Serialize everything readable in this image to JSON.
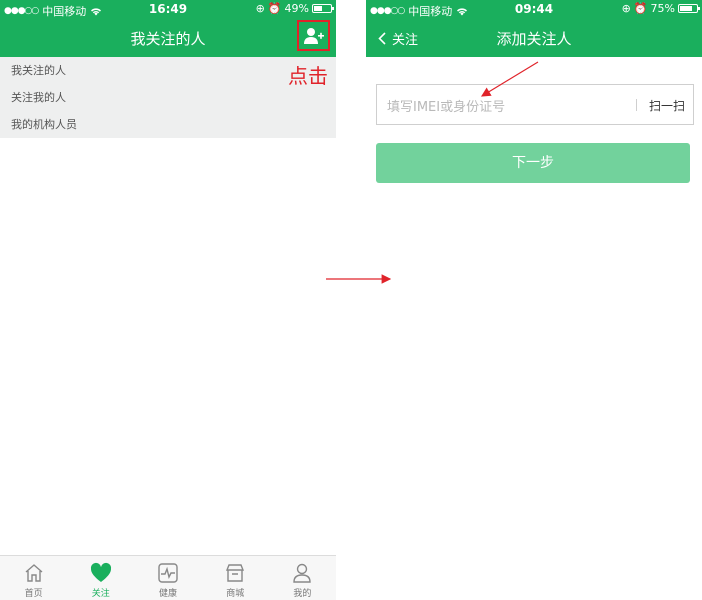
{
  "left_screen": {
    "status": {
      "carrier": "中国移动",
      "time": "16:49",
      "battery": "49%",
      "battery_level": 0.49
    },
    "nav": {
      "title": "我关注的人",
      "add_icon": "add-user-icon"
    },
    "menu": [
      "我关注的人",
      "关注我的人",
      "我的机构人员"
    ],
    "annotation": "点击",
    "tabs": [
      {
        "label": "首页",
        "icon": "home-icon",
        "active": false
      },
      {
        "label": "关注",
        "icon": "heart-icon",
        "active": true
      },
      {
        "label": "健康",
        "icon": "health-icon",
        "active": false
      },
      {
        "label": "商城",
        "icon": "store-icon",
        "active": false
      },
      {
        "label": "我的",
        "icon": "person-icon",
        "active": false
      }
    ]
  },
  "right_screen": {
    "status": {
      "carrier": "中国移动",
      "time": "09:44",
      "battery": "75%",
      "battery_level": 0.75
    },
    "nav": {
      "back_label": "关注",
      "title": "添加关注人"
    },
    "input": {
      "placeholder": "填写IMEI或身份证号",
      "scan_label": "扫一扫"
    },
    "next_button": "下一步"
  },
  "colors": {
    "brand_green": "#1aaf5d",
    "button_green_disabled": "#72d29c",
    "annotation_red": "#e0232a",
    "menu_bg": "#eeefef"
  }
}
